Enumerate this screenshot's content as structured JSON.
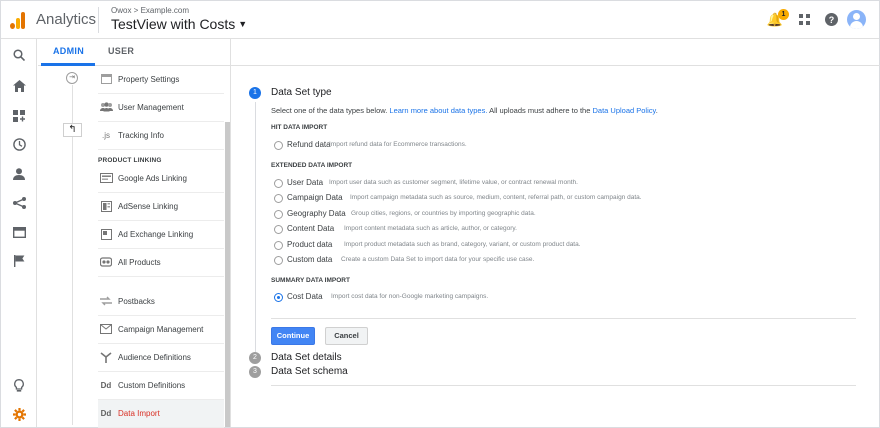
{
  "header": {
    "app_name": "Analytics",
    "breadcrumb": "Owox > Example.com",
    "view_title": "TestView with Costs",
    "notification_count": "1",
    "icons": [
      "bell-icon",
      "apps-grid-icon",
      "help-icon",
      "avatar"
    ]
  },
  "rail": {
    "icons": [
      "search-icon",
      "home-icon",
      "customization-icon",
      "realtime-clock-icon",
      "audience-icon",
      "acquisition-icon",
      "behavior-icon",
      "conversions-flag-icon",
      "lightbulb-icon",
      "settings-gear-icon"
    ]
  },
  "tabs": {
    "admin": "ADMIN",
    "user": "USER"
  },
  "menu": {
    "items_top": [
      {
        "label": "Property Settings",
        "icon": "settings-icon"
      },
      {
        "label": "User Management",
        "icon": "users-icon"
      },
      {
        "label": "Tracking Info",
        "icon": "js-icon"
      }
    ],
    "section_product_linking": "PRODUCT LINKING",
    "items_linking": [
      {
        "label": "Google Ads Linking",
        "icon": "ads-icon"
      },
      {
        "label": "AdSense Linking",
        "icon": "adsense-icon"
      },
      {
        "label": "Ad Exchange Linking",
        "icon": "ad-exchange-icon"
      },
      {
        "label": "All Products",
        "icon": "link-icon"
      }
    ],
    "items_bottom": [
      {
        "label": "Postbacks",
        "icon": "postbacks-icon"
      },
      {
        "label": "Campaign Management",
        "icon": "campaign-icon"
      },
      {
        "label": "Audience Definitions",
        "icon": "audience-definitions-icon"
      },
      {
        "label": "Custom Definitions",
        "icon": "dd-icon"
      },
      {
        "label": "Data Import",
        "icon": "dd-icon",
        "active": true
      }
    ]
  },
  "steps": {
    "step1": {
      "num": "1",
      "title": "Data Set type"
    },
    "step2": {
      "num": "2",
      "title": "Data Set details"
    },
    "step3": {
      "num": "3",
      "title": "Data Set schema"
    }
  },
  "description": {
    "prefix": "Select one of the data types below. ",
    "link1": "Learn more about data types.",
    "middle": " All uploads must adhere to the ",
    "link2": "Data Upload Policy",
    "suffix": "."
  },
  "sections": {
    "hit": "HIT DATA IMPORT",
    "extended": "EXTENDED DATA IMPORT",
    "summary": "SUMMARY DATA IMPORT"
  },
  "options": {
    "refund": {
      "label": "Refund data",
      "hint": "Import refund data for Ecommerce transactions."
    },
    "user": {
      "label": "User Data",
      "hint": "Import user data such as customer segment, lifetime value, or contract renewal month."
    },
    "campaign": {
      "label": "Campaign Data",
      "hint": "Import campaign metadata such as source, medium, content, referral path, or custom campaign data."
    },
    "geography": {
      "label": "Geography Data",
      "hint": "Group cities, regions, or countries by importing geographic data."
    },
    "content": {
      "label": "Content Data",
      "hint": "Import content metadata such as article, author, or category."
    },
    "product": {
      "label": "Product data",
      "hint": "Import product metadata such as brand, category, variant, or custom product data."
    },
    "custom": {
      "label": "Custom data",
      "hint": "Create a custom Data Set to import data for your specific use case."
    },
    "cost": {
      "label": "Cost Data",
      "hint": "Import cost data for non-Google marketing campaigns.",
      "selected": true
    }
  },
  "buttons": {
    "continue": "Continue",
    "cancel": "Cancel"
  },
  "colors": {
    "accent": "#1a73e8",
    "brand_orange": "#e37400",
    "active_menu_text": "#d93025"
  }
}
